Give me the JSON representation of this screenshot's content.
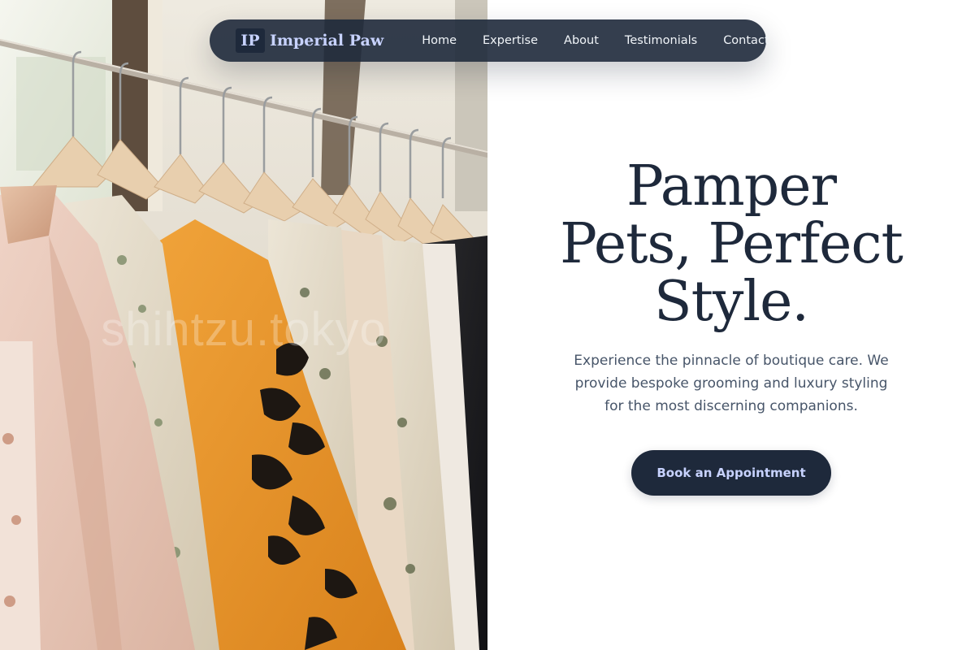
{
  "nav": {
    "logo_mark": "IP",
    "brand_name": "Imperial Paw",
    "links": [
      "Home",
      "Expertise",
      "About",
      "Testimonials",
      "Contact"
    ]
  },
  "hero": {
    "title_lines": [
      "Pamper",
      "Pets, Perfect",
      "Style."
    ],
    "subtitle": "Experience the pinnacle of boutique care. We provide bespoke grooming and luxury styling for the most discerning companions.",
    "cta_label": "Book an Appointment"
  },
  "image": {
    "description_icon": "clothing-rack-photo",
    "watermark": "shihtzu.tokyo"
  },
  "colors": {
    "navy": "#1e293b",
    "accent": "#c7d2fe",
    "body_text": "#475569",
    "background": "#ffffff"
  }
}
